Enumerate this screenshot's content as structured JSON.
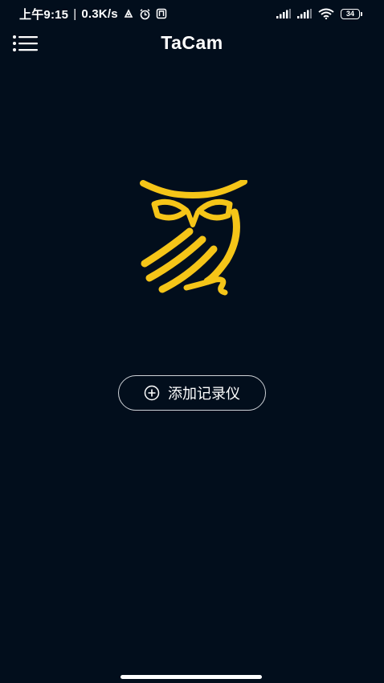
{
  "status_bar": {
    "time": "上午9:15",
    "separator": "|",
    "network_speed": "0.3K/s",
    "battery_level": "34"
  },
  "app_bar": {
    "title": "TaCam"
  },
  "main": {
    "add_button_label": "添加记录仪"
  },
  "colors": {
    "background": "#020e1c",
    "logo": "#f5c518",
    "button_border": "#cfd3d8"
  },
  "icons": [
    "menu-icon",
    "owl-logo",
    "plus-circle-icon",
    "signal-icon",
    "wifi-icon",
    "alarm-icon",
    "battery-icon"
  ]
}
